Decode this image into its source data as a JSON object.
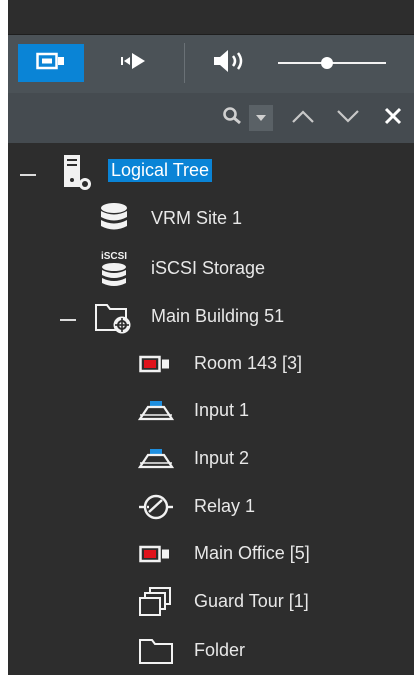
{
  "toolbar": {
    "buttons": [
      {
        "name": "camera",
        "icon": "camera-mode-icon",
        "active": true
      },
      {
        "name": "playback",
        "icon": "playback-icon",
        "active": false
      },
      {
        "name": "volume",
        "icon": "speaker-icon",
        "active": false
      }
    ],
    "volume_level": 0.45,
    "accent_color": "#0a84d6"
  },
  "searchbar": {
    "icons": [
      "search-icon",
      "chevron-down-icon",
      "chevron-up-icon",
      "chevron-down-icon",
      "close-icon"
    ]
  },
  "tree": {
    "items": [
      {
        "label": "Logical Tree",
        "icon": "server-icon",
        "selected": true,
        "expanded": true
      },
      {
        "label": "VRM Site 1",
        "icon": "database-icon"
      },
      {
        "label": "iSCSI Storage",
        "icon": "iscsi-storage-icon",
        "icon_text": "iSCSI"
      },
      {
        "label": "Main Building 51",
        "icon": "folder-site-icon",
        "expanded": true
      },
      {
        "label": "Room 143 [3]",
        "icon": "camera-icon"
      },
      {
        "label": "Input 1",
        "icon": "input-icon"
      },
      {
        "label": "Input 2",
        "icon": "input-icon"
      },
      {
        "label": "Relay 1",
        "icon": "relay-icon"
      },
      {
        "label": "Main Office [5]",
        "icon": "camera-icon"
      },
      {
        "label": "Guard Tour [1]",
        "icon": "guard-tour-icon"
      },
      {
        "label": "Folder",
        "icon": "folder-icon"
      }
    ]
  }
}
